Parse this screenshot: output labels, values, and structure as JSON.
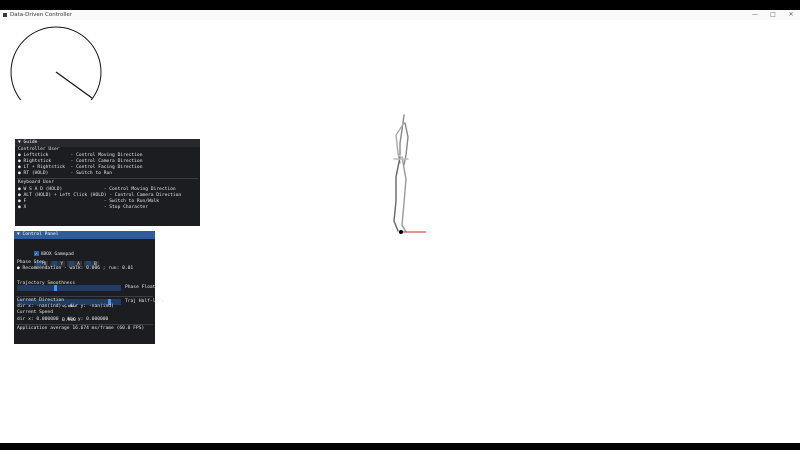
{
  "window": {
    "title": "Data-Driven Controller",
    "minimize_glyph": "—",
    "maximize_glyph": "□",
    "close_glyph": "✕"
  },
  "guide": {
    "header": "▼ Guide",
    "controller_title": "Controller User",
    "controller_lines": [
      "● Leftstick        - Control Moving Direction",
      "● Rightstick       - Control Camera Direction",
      "● LT + Rightstick  - Control Facing Direction",
      "● RT (HOLD)        - Switch to Run"
    ],
    "keyboard_title": "Keyboard User",
    "keyboard_lines": [
      "● W S A D (HOLD)               - Control Moving Direction",
      "● ALT (HOLD) + Left Click (HOLD) - Control Camera Direction",
      "● F                            - Switch to Run/Walk",
      "● X                            - Stop Character"
    ]
  },
  "control_panel": {
    "header": "▼ Control Panel",
    "gamepad_label": "XBOX Gamepad",
    "gamepad_checked": true,
    "buttons": [
      "X",
      "Y",
      "A",
      "B"
    ],
    "phase_step_title": "Phase Step",
    "recommendation": "● Recommendation - walk: 0.006 ; run: 0.01",
    "phase_float_value": "0.006",
    "phase_float_label": "Phase Float",
    "phase_float_fraction": 0.37,
    "traj_smooth_title": "Trajectory Smoothness",
    "traj_value": "0.900",
    "traj_label": "Traj Half-life",
    "traj_fraction": 0.9,
    "direction_title": "Current Direction",
    "direction_value": "dir x: -nan(ind) ; dir y: -nan(ind)",
    "speed_title": "Current Speed",
    "speed_value": "dir x: 0.000000 ; dir y: 0.000000",
    "fps_text": "Application average 16.674 ms/frame (60.0 FPS)"
  }
}
